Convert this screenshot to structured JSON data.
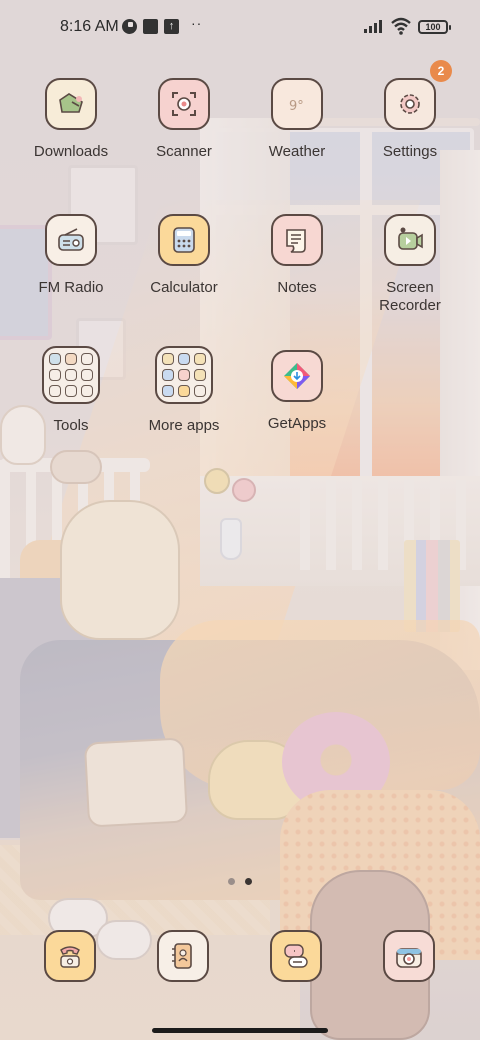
{
  "status_bar": {
    "time": "8:16 AM",
    "notification_icons": [
      "edge-icon",
      "square-icon",
      "upload-icon"
    ],
    "more_indicator": "··",
    "battery": "100"
  },
  "home": {
    "apps": [
      {
        "label": "Downloads",
        "icon": "download-icon",
        "bg": "#f7ecd8"
      },
      {
        "label": "Scanner",
        "icon": "scanner-icon",
        "bg": "#f6d2cf"
      },
      {
        "label": "Weather",
        "icon": "weather-icon",
        "bg": "#f8e8dd"
      },
      {
        "label": "Settings",
        "icon": "gear-icon",
        "bg": "#f6e8de"
      },
      {
        "label": "FM Radio",
        "icon": "radio-icon",
        "bg": "#f8efe6"
      },
      {
        "label": "Calculator",
        "icon": "calculator-icon",
        "bg": "#fbd99a"
      },
      {
        "label": "Notes",
        "icon": "notes-icon",
        "bg": "#f7d7d2"
      },
      {
        "label": "Screen\nRecorder",
        "icon": "video-icon",
        "bg": "#f6eee4"
      },
      {
        "label": "Tools",
        "icon": "folder-icon"
      },
      {
        "label": "More apps",
        "icon": "folder-icon"
      },
      {
        "label": "GetApps",
        "icon": "getapps-icon",
        "bg": "#f7d9d3"
      }
    ],
    "settings_badge": "2"
  },
  "dock": [
    {
      "name": "phone",
      "icon": "phone-icon",
      "bg": "#fbd99a"
    },
    {
      "name": "contacts",
      "icon": "contacts-icon",
      "bg": "#f7efe7"
    },
    {
      "name": "messages",
      "icon": "message-icon",
      "bg": "#fbd99a"
    },
    {
      "name": "camera",
      "icon": "camera-icon",
      "bg": "#f7dcd6"
    }
  ],
  "page_indicator": {
    "pages": 2,
    "current": 2
  },
  "colors": {
    "label": "#3b3533",
    "icon_border": "#5b4a44",
    "badge": "#e98a4b"
  }
}
